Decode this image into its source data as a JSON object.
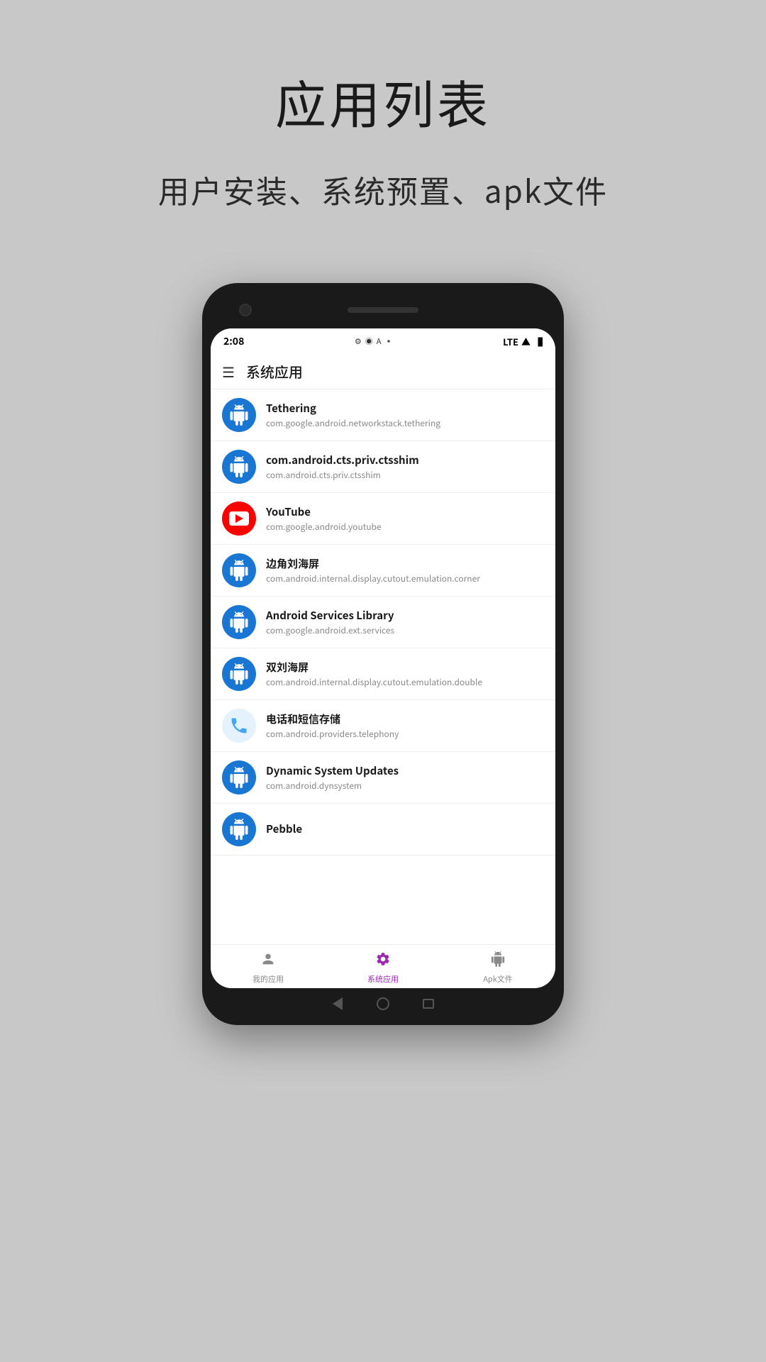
{
  "page": {
    "title": "应用列表",
    "subtitle": "用户安装、系统预置、apk文件"
  },
  "phone": {
    "status": {
      "time": "2:08",
      "network": "LTE",
      "icons": [
        "⚙",
        "◉",
        "A",
        "🔋"
      ]
    },
    "app_bar": {
      "title": "系统应用"
    },
    "apps": [
      {
        "name": "Tethering",
        "package": "com.google.android.networkstack.tethering",
        "icon_type": "android",
        "id": "tethering"
      },
      {
        "name": "com.android.cts.priv.ctsshim",
        "package": "com.android.cts.priv.ctsshim",
        "icon_type": "android",
        "id": "ctsshim"
      },
      {
        "name": "YouTube",
        "package": "com.google.android.youtube",
        "icon_type": "youtube",
        "id": "youtube"
      },
      {
        "name": "边角刘海屏",
        "package": "com.android.internal.display.cutout.emulation.corner",
        "icon_type": "android",
        "id": "corner-cutout"
      },
      {
        "name": "Android Services Library",
        "package": "com.google.android.ext.services",
        "icon_type": "android",
        "id": "ext-services"
      },
      {
        "name": "双刘海屏",
        "package": "com.android.internal.display.cutout.emulation.double",
        "icon_type": "android",
        "id": "double-cutout"
      },
      {
        "name": "电话和短信存储",
        "package": "com.android.providers.telephony",
        "icon_type": "phone",
        "id": "telephony"
      },
      {
        "name": "Dynamic System Updates",
        "package": "com.android.dynsystem",
        "icon_type": "android",
        "id": "dynsystem"
      },
      {
        "name": "Pebble",
        "package": "",
        "icon_type": "android",
        "id": "pebble"
      }
    ],
    "bottom_nav": {
      "items": [
        {
          "label": "我的应用",
          "icon": "person",
          "active": false,
          "id": "my-apps"
        },
        {
          "label": "系统应用",
          "icon": "gear",
          "active": true,
          "id": "system-apps"
        },
        {
          "label": "Apk文件",
          "icon": "android",
          "active": false,
          "id": "apk-files"
        }
      ]
    },
    "nav_buttons": {
      "back": "◁",
      "home": "○",
      "recent": "□"
    }
  }
}
